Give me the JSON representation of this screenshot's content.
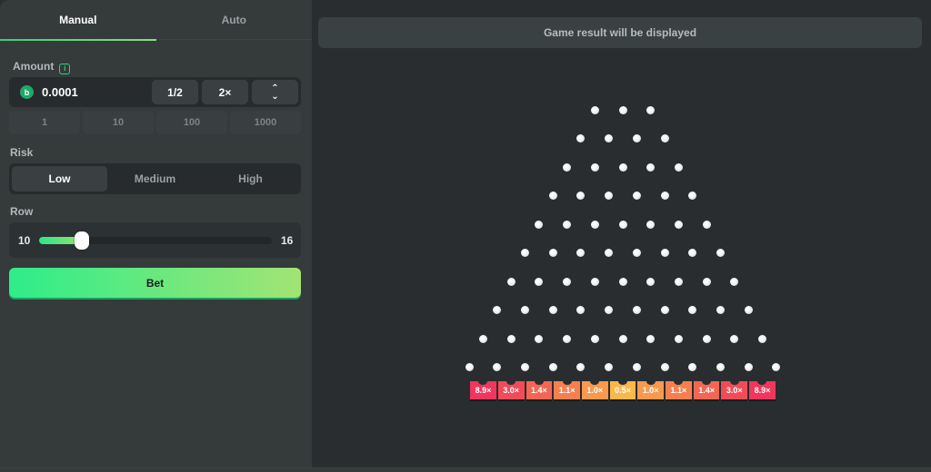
{
  "tabs": [
    {
      "label": "Manual",
      "active": true
    },
    {
      "label": "Auto",
      "active": false
    }
  ],
  "amount": {
    "label": "Amount",
    "info_icon": "info-icon",
    "currency_icon": "coin-icon",
    "currency_glyph": "b",
    "value": "0.0001",
    "half_label": "1/2",
    "double_label": "2×",
    "up_glyph": "⌃",
    "down_glyph": "⌄",
    "presets": [
      "1",
      "10",
      "100",
      "1000"
    ]
  },
  "risk": {
    "label": "Risk",
    "options": [
      "Low",
      "Medium",
      "High"
    ],
    "selected": "Low"
  },
  "row": {
    "label": "Row",
    "min": "10",
    "max": "16",
    "value": 11,
    "min_value": 10,
    "max_value": 16
  },
  "bet_label": "Bet",
  "result_text": "Game result will be displayed",
  "board": {
    "rows": 10,
    "multipliers": [
      "8.9×",
      "3.0×",
      "1.4×",
      "1.1×",
      "1.0×",
      "0.5×",
      "1.0×",
      "1.1×",
      "1.4×",
      "3.0×",
      "8.9×"
    ],
    "slot_colors": [
      "#f0365c",
      "#f24b58",
      "#f46654",
      "#f67f50",
      "#f8994d",
      "#fbb84a",
      "#f8994d",
      "#f67f50",
      "#f46654",
      "#f24b58",
      "#f0365c"
    ]
  }
}
